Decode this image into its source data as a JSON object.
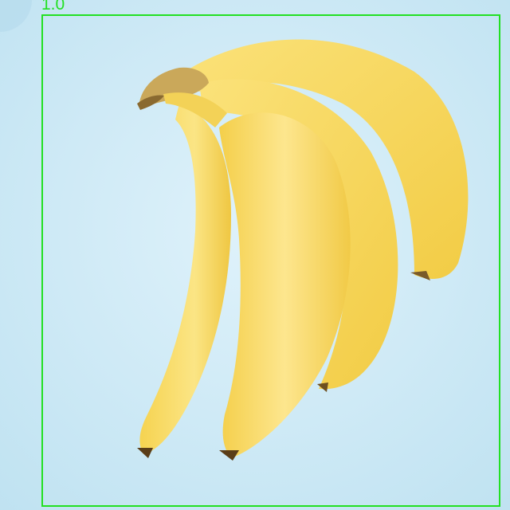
{
  "image": {
    "subject": "banana-bunch",
    "background_color": "#cfe9f5",
    "banana_color": "#f7d85a"
  },
  "detections": [
    {
      "score_label": "1.0",
      "box_color": "#22e022"
    }
  ]
}
